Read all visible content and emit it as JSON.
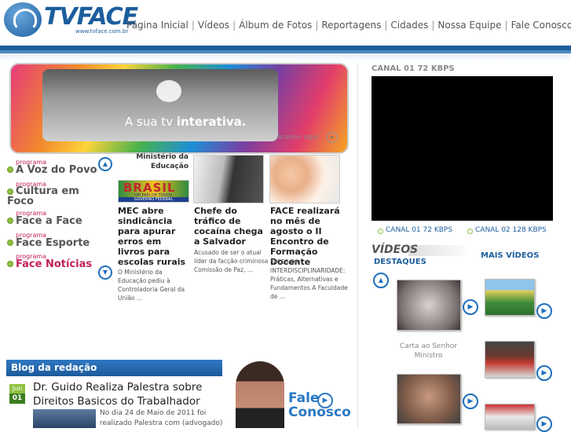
{
  "header": {
    "logo": {
      "tv": "TV",
      "face": "FACE",
      "url": "www.tvface.com.br"
    },
    "nav": [
      "Página Inicial",
      "Vídeos",
      "Álbum de Fotos",
      "Reportagens",
      "Cidades",
      "Nossa Equipe",
      "Fale Conosco"
    ]
  },
  "banner": {
    "tagline_prefix": "A sua tv ",
    "tagline_bold": "interativa.",
    "access": "Acesse aqui"
  },
  "programs": [
    {
      "small": "programa",
      "name": "A Voz do Povo",
      "color": "#555555"
    },
    {
      "small": "programa",
      "name": "Cultura em Foco",
      "color": "#555555"
    },
    {
      "small": "programa",
      "name": "Face a Face",
      "color": "#555555"
    },
    {
      "small": "programa",
      "name": "Face Esporte",
      "color": "#555555"
    },
    {
      "small": "programa",
      "name": "Face Notícias",
      "color": "#c0225c"
    }
  ],
  "news": [
    {
      "caption": "Ministério da Educação",
      "logo_text": "BRASIL",
      "logo_sub": "UM PAÍS DE TODOS",
      "logo_gov": "GOVERNO FEDERAL",
      "title": "MEC abre sindicância para apurar erros em livros para escolas rurais",
      "summary": "O Ministério da Educação pediu à Controladoria Geral da União ..."
    },
    {
      "title": "Chefe do tráfico de cocaína chega a Salvador",
      "summary": "Acusado de ser o atual líder da facção criminosa Comissão de Paz, ..."
    },
    {
      "title": "FACE realizará no mês de agosto o II Encontro de Formação Docente",
      "summary": "FACES DA INTERDISCIPLINARIDADE: Práticas, Alternativas e Fundamentos A Faculdade de ..."
    }
  ],
  "player": {
    "label": "CANAL 01 72 KBPS",
    "links": [
      "CANAL 01 72 KBPS",
      "CANAL 02 128 KBPS"
    ]
  },
  "videos": {
    "heading": "VÍDEOS",
    "destaques": "DESTAQUES",
    "mais": "MAIS VÍDEOS",
    "featured_caption": "Carta ao Senhor Ministro"
  },
  "blog": {
    "heading": "Blog da redação",
    "month": "Jun",
    "day": "01",
    "post_title": "Dr. Guido Realiza Palestra sobre Direitos Basicos do Trabalhador",
    "excerpt": "No dia 24 de Maio de 2011 foi realizado Palestra com (advogado)"
  },
  "fale": {
    "line1": "Fale",
    "line2": "Conosco"
  },
  "colors": {
    "brand": "#1d5e9e",
    "accent_program": "#c0225c",
    "green": "#8fbf3f"
  }
}
